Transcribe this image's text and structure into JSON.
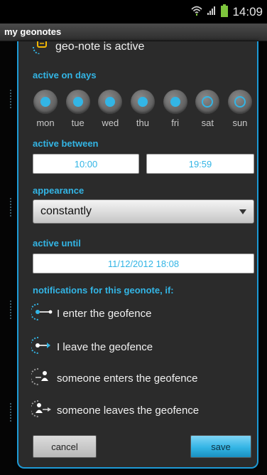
{
  "status_bar": {
    "time": "14:09"
  },
  "app": {
    "title": "my geonotes"
  },
  "dialog": {
    "geo_active_label": "geo-note is active",
    "days_header": "active on days",
    "days": [
      {
        "label": "mon",
        "active": true
      },
      {
        "label": "tue",
        "active": true
      },
      {
        "label": "wed",
        "active": true
      },
      {
        "label": "thu",
        "active": true
      },
      {
        "label": "fri",
        "active": true
      },
      {
        "label": "sat",
        "active": false
      },
      {
        "label": "sun",
        "active": false
      }
    ],
    "between_header": "active between",
    "start_time": "10:00",
    "end_time": "19:59",
    "appearance_header": "appearance",
    "appearance_value": "constantly",
    "until_header": "active until",
    "until_value": "11/12/2012 18:08",
    "notifications_header": "notifications for this geonote, if:",
    "notifications": [
      {
        "label": "I enter the geofence",
        "icon": "enter-geofence-icon",
        "checked": true
      },
      {
        "label": "I leave the geofence",
        "icon": "leave-geofence-icon",
        "checked": true
      },
      {
        "label": "someone enters the geofence",
        "icon": "someone-enters-icon",
        "checked": false
      },
      {
        "label": "someone leaves the geofence",
        "icon": "someone-leaves-icon",
        "checked": false
      }
    ],
    "cancel_label": "cancel",
    "save_label": "save"
  },
  "colors": {
    "accent": "#33b5e5",
    "dialog_border": "#1d9ad6",
    "dialog_bg": "#2b2b2b"
  }
}
